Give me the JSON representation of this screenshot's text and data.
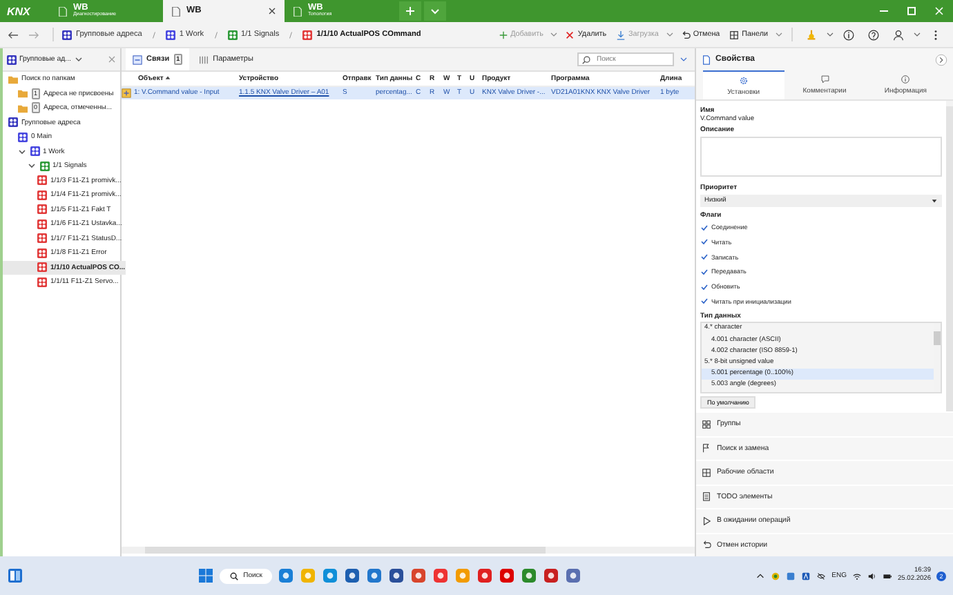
{
  "title_bar": {
    "logo": "KNX",
    "tabs": [
      {
        "title": "WB",
        "subtitle": "Диагностирование",
        "selected": false
      },
      {
        "title": "WB",
        "selected": true
      },
      {
        "title": "WB",
        "subtitle": "Топология",
        "selected": false
      }
    ]
  },
  "toolbar": {
    "breadcrumbs": [
      {
        "label": "Групповые адреса",
        "kind": "root"
      },
      {
        "label": "1 Work",
        "kind": "main"
      },
      {
        "label": "1/1 Signals",
        "kind": "middle"
      },
      {
        "label": "1/1/10 ActualPOS COmmand",
        "kind": "address"
      }
    ],
    "actions": [
      {
        "label": "Добавить",
        "kind": "add",
        "disabled": true
      },
      {
        "label": "Удалить",
        "kind": "delete",
        "disabled": false
      },
      {
        "label": "Загрузка",
        "kind": "download",
        "disabled": true
      },
      {
        "label": "Отмена",
        "kind": "undo",
        "disabled": false
      },
      {
        "label": "Панели",
        "kind": "panels",
        "disabled": false
      }
    ]
  },
  "sidebar": {
    "selector": "Групповые ад...",
    "tree": [
      {
        "label": "Поиск по папкам",
        "kind": "folder",
        "selected": false,
        "children": [
          {
            "label": "Адреса не присвоены",
            "count": "1",
            "kind": "folder",
            "selected": false
          },
          {
            "label": "Адреса, отмеченны...",
            "count": "0",
            "kind": "folder",
            "selected": false
          }
        ]
      },
      {
        "label": "Групповые адреса",
        "kind": "root",
        "selected": false,
        "children": [
          {
            "label": "0 Main",
            "kind": "main",
            "selected": false
          },
          {
            "label": "1 Work",
            "kind": "main",
            "selected": false,
            "expanded": true,
            "children": [
              {
                "label": "1/1 Signals",
                "kind": "middle",
                "selected": false,
                "expanded": true,
                "children": [
                  {
                    "label": "1/1/3 F11-Z1 promivk...",
                    "kind": "address",
                    "selected": false
                  },
                  {
                    "label": "1/1/4 F11-Z1 promivk...",
                    "kind": "address",
                    "selected": false
                  },
                  {
                    "label": "1/1/5 F11-Z1 Fakt T",
                    "kind": "address",
                    "selected": false
                  },
                  {
                    "label": "1/1/6 F11-Z1 Ustavka...",
                    "kind": "address",
                    "selected": false
                  },
                  {
                    "label": "1/1/7 F11-Z1  StatusD...",
                    "kind": "address",
                    "selected": false
                  },
                  {
                    "label": "1/1/8 F11-Z1 Error",
                    "kind": "address",
                    "selected": false
                  },
                  {
                    "label": "1/1/10 ActualPOS CO...",
                    "kind": "address",
                    "selected": true
                  },
                  {
                    "label": "1/1/11 F11-Z1  Servo...",
                    "kind": "address",
                    "selected": false
                  }
                ]
              }
            ]
          }
        ]
      }
    ]
  },
  "center": {
    "tabs": [
      {
        "label": "Связи",
        "count": "1",
        "selected": true
      },
      {
        "label": "Параметры",
        "selected": false
      }
    ],
    "search": {
      "placeholder": "Поиск"
    },
    "table": {
      "columns": [
        "Объект",
        "Устройство",
        "Отправк",
        "Тип данны",
        "C",
        "R",
        "W",
        "T",
        "U",
        "Продукт",
        "Программа",
        "Длина"
      ],
      "rows": [
        {
          "selected": true,
          "cells": [
            "1: V.Command value - Input",
            "1.1.5 KNX Valve Driver – A01",
            "S",
            "percentag...",
            "C",
            "R",
            "W",
            "T",
            "U",
            "KNX Valve Driver -...",
            "VD21A01KNX KNX Valve Driver",
            "1 byte"
          ]
        }
      ]
    }
  },
  "properties": {
    "title": "Свойства",
    "tabs": [
      {
        "label": "Установки",
        "selected": true
      },
      {
        "label": "Комментарии",
        "selected": false
      },
      {
        "label": "Информация",
        "selected": false
      }
    ],
    "name_label": "Имя",
    "name_value": "V.Command value",
    "description_label": "Описание",
    "priority_label": "Приоритет",
    "priority_value": "Низкий",
    "flags_label": "Флаги",
    "flags": [
      {
        "label": "Соединение",
        "checked": true
      },
      {
        "label": "Читать",
        "checked": true
      },
      {
        "label": "Записать",
        "checked": true
      },
      {
        "label": "Передавать",
        "checked": true
      },
      {
        "label": "Обновить",
        "checked": true
      },
      {
        "label": "Читать при инициализации",
        "checked": true
      }
    ],
    "datatype_label": "Тип данных",
    "datatypes": [
      {
        "label": "4.* character",
        "selected": false,
        "children": [
          {
            "label": "4.001 character (ASCII)",
            "selected": false
          },
          {
            "label": "4.002 character (ISO 8859-1)",
            "selected": false
          }
        ]
      },
      {
        "label": "5.* 8-bit unsigned value",
        "selected": false,
        "children": [
          {
            "label": "5.001 percentage (0..100%)",
            "selected": true
          },
          {
            "label": "5.003 angle (degrees)",
            "selected": false
          }
        ]
      }
    ],
    "default_button": "По умолчанию"
  },
  "panels": [
    "Группы",
    "Поиск и замена",
    "Рабочие области",
    "TODO элементы",
    "В ожидании операций",
    "Отмен истории"
  ],
  "taskbar": {
    "search": "Поиск",
    "language": "ENG",
    "time": "16:39",
    "date": "25.02.2026",
    "notifications": "2"
  }
}
